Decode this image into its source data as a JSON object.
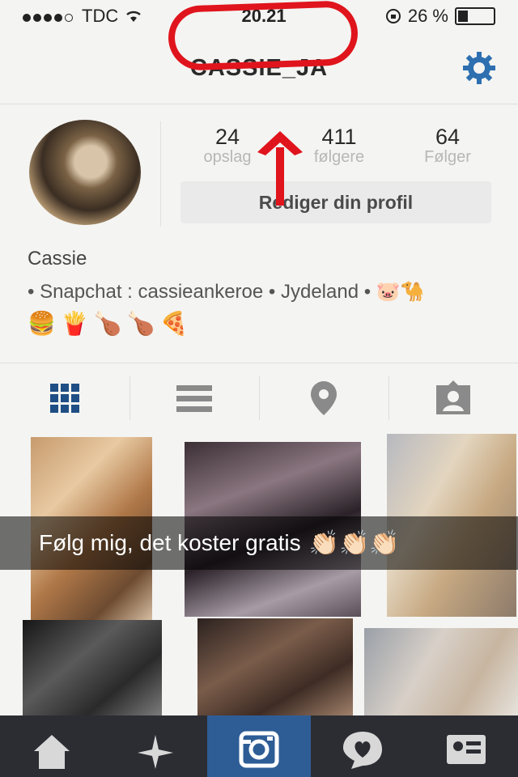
{
  "status_bar": {
    "carrier": "TDC",
    "time": "20.21",
    "battery": "26 %",
    "battery_level": 0.26
  },
  "header": {
    "username": "CASSIE_JA",
    "settings_icon": "gear-icon"
  },
  "stats": [
    {
      "count": "24",
      "label": "opslag"
    },
    {
      "count": "411",
      "label": "følgere"
    },
    {
      "count": "64",
      "label": "Følger"
    }
  ],
  "edit_profile_label": "Rediger din profil",
  "bio": {
    "name": "Cassie",
    "line1": "• Snapchat : cassieankeroe • Jydeland •",
    "line1_emojis": "🐷🐪",
    "emojis": [
      "🍔",
      "🍟",
      "🍗",
      "🍗",
      "🍕"
    ]
  },
  "tabs": [
    "grid-icon",
    "list-icon",
    "location-pin-icon",
    "tagged-photos-icon"
  ],
  "caption": {
    "text": "Følg mig, det koster gratis",
    "emojis": "👏🏻👏🏻👏🏻"
  },
  "bottom_nav": [
    "home-icon",
    "explore-icon",
    "camera-icon",
    "activity-icon",
    "profile-icon"
  ],
  "colors": {
    "annotation_red": "#e0141c",
    "accent_blue": "#2e5d96",
    "icon_blue": "#1f4e85",
    "nav_bg": "#2c2d33"
  }
}
